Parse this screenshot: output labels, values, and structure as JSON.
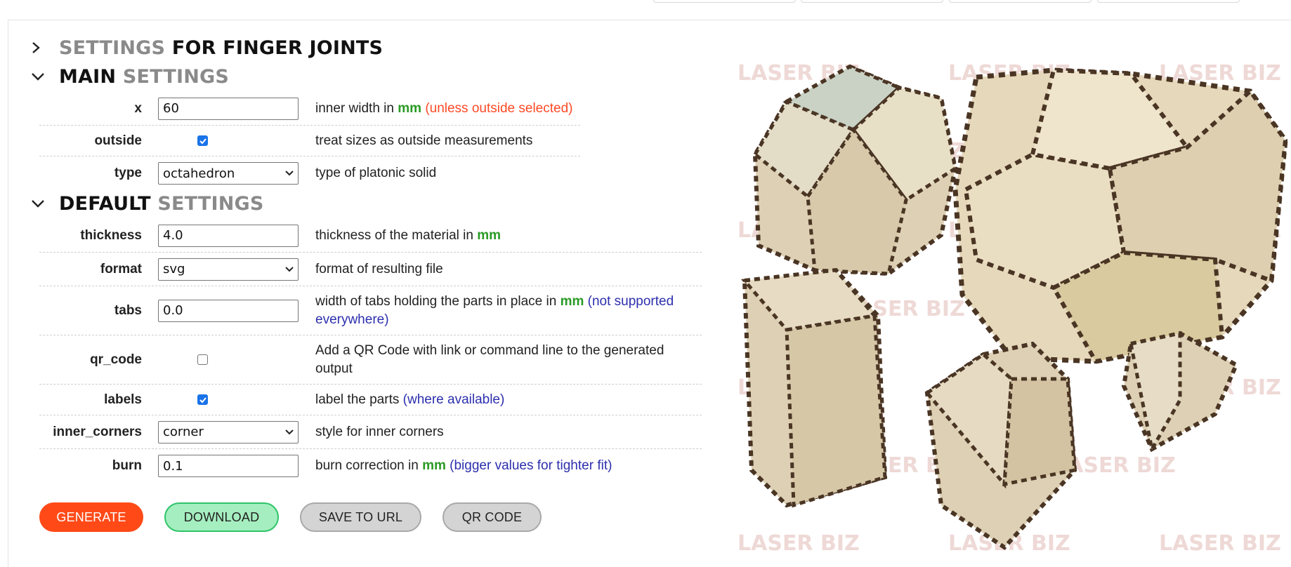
{
  "sections": {
    "finger_joints": {
      "word1": "SETTINGS",
      "word2": "FOR FINGER JOINTS"
    },
    "main": {
      "word1": "MAIN",
      "word2": "SETTINGS"
    },
    "default": {
      "word1": "DEFAULT",
      "word2": "SETTINGS"
    }
  },
  "main_settings": {
    "x": {
      "label": "x",
      "value": "60",
      "desc_pre": "inner width in ",
      "unit": "mm",
      "note": "(unless outside selected)"
    },
    "outside": {
      "label": "outside",
      "checked": true,
      "desc": "treat sizes as outside measurements"
    },
    "type": {
      "label": "type",
      "value": "octahedron",
      "desc": "type of platonic solid"
    }
  },
  "default_settings": {
    "thickness": {
      "label": "thickness",
      "value": "4.0",
      "desc_pre": "thickness of the material in ",
      "unit": "mm"
    },
    "format": {
      "label": "format",
      "value": "svg",
      "desc": "format of resulting file"
    },
    "tabs": {
      "label": "tabs",
      "value": "0.0",
      "desc_pre": "width of tabs holding the parts in place in ",
      "unit": "mm",
      "note": "(not supported everywhere)"
    },
    "qr_code": {
      "label": "qr_code",
      "checked": false,
      "desc": "Add a QR Code with link or command line to the generated output"
    },
    "labels": {
      "label": "labels",
      "checked": true,
      "desc_pre": "label the parts ",
      "note": "(where available)"
    },
    "inner_corners": {
      "label": "inner_corners",
      "value": "corner",
      "desc": "style for inner corners"
    },
    "burn": {
      "label": "burn",
      "value": "0.1",
      "desc_pre": "burn correction in ",
      "unit": "mm",
      "note": "(bigger values for tighter fit)"
    }
  },
  "buttons": {
    "generate": "GENERATE",
    "download": "DOWNLOAD",
    "save_to_url": "SAVE TO URL",
    "qr_code": "QR CODE"
  },
  "watermark": "LASER BIZ",
  "colors": {
    "accent": "#ff4a18",
    "unit_green": "#2a9a25",
    "note_blue": "#2c2fad",
    "note_red": "#ff4a26"
  }
}
